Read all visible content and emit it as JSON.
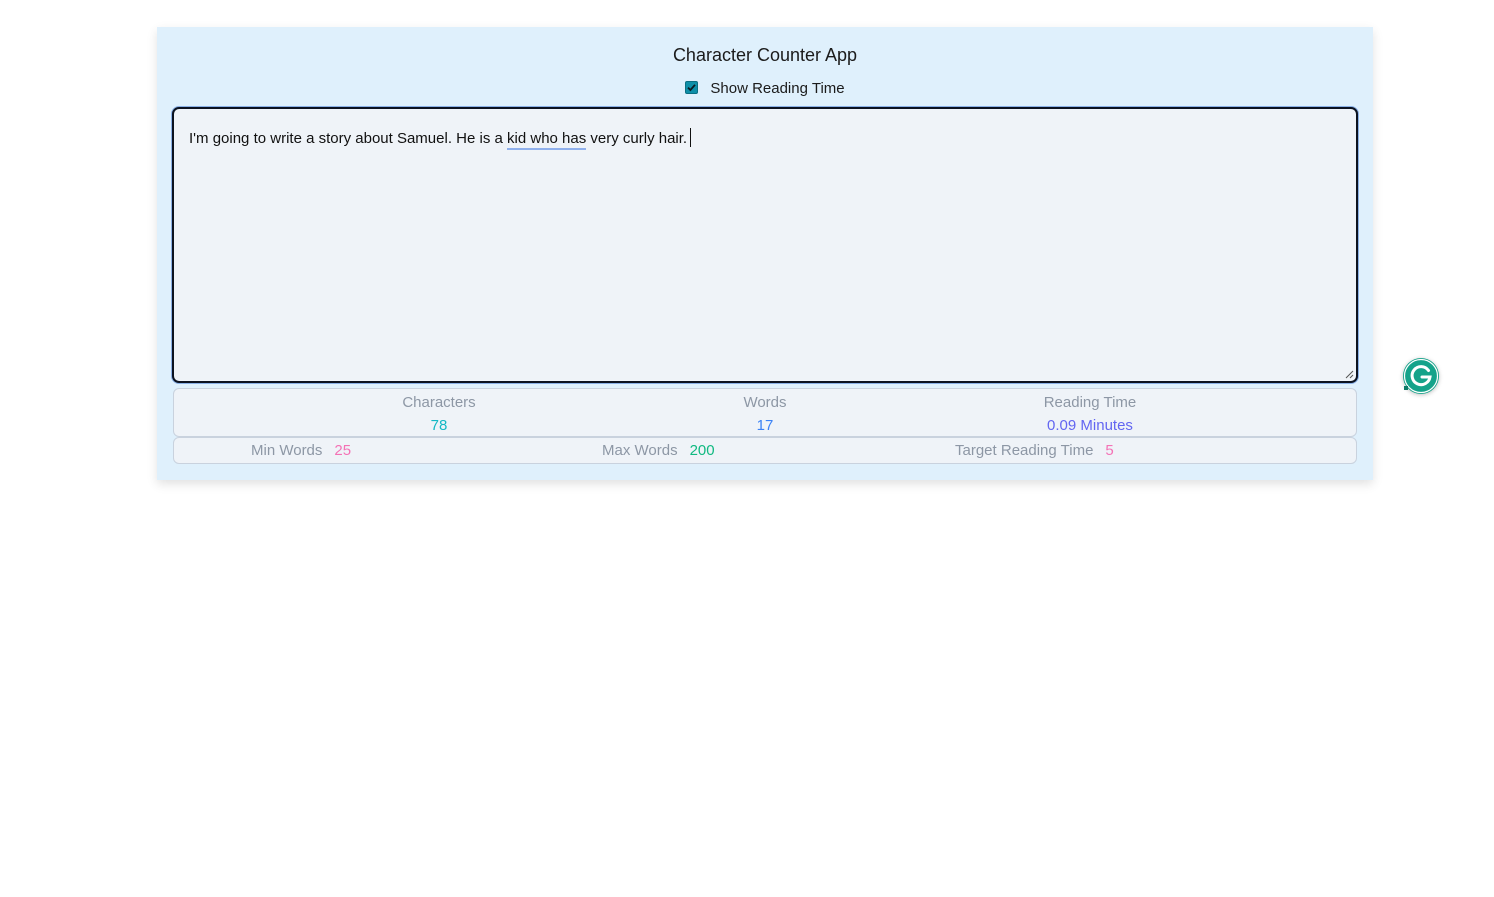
{
  "app": {
    "title": "Character Counter App"
  },
  "reading_time_toggle": {
    "label": "Show Reading Time",
    "checked": true,
    "accent_color": "#0e8fa8"
  },
  "editor": {
    "text_before": "I'm going to write a story about Samuel. He is a ",
    "text_flagged": "kid who has",
    "text_after": " very curly hair."
  },
  "stats": {
    "characters": {
      "label": "Characters",
      "value": "78",
      "color": "#14b8c4"
    },
    "words": {
      "label": "Words",
      "value": "17",
      "color": "#3b82f6"
    },
    "reading_time": {
      "label": "Reading Time",
      "value": "0.09 Minutes",
      "color": "#6366f1"
    }
  },
  "limits": {
    "min_words": {
      "label": "Min Words",
      "value": "25",
      "color": "#f472b6"
    },
    "max_words": {
      "label": "Max Words",
      "value": "200",
      "color": "#10b981"
    },
    "target_reading_time": {
      "label": "Target Reading Time",
      "value": "5",
      "color": "#f472b6"
    }
  },
  "grammarly_widget": {
    "icon": "grammarly-g-icon",
    "color": "#15a38a"
  }
}
